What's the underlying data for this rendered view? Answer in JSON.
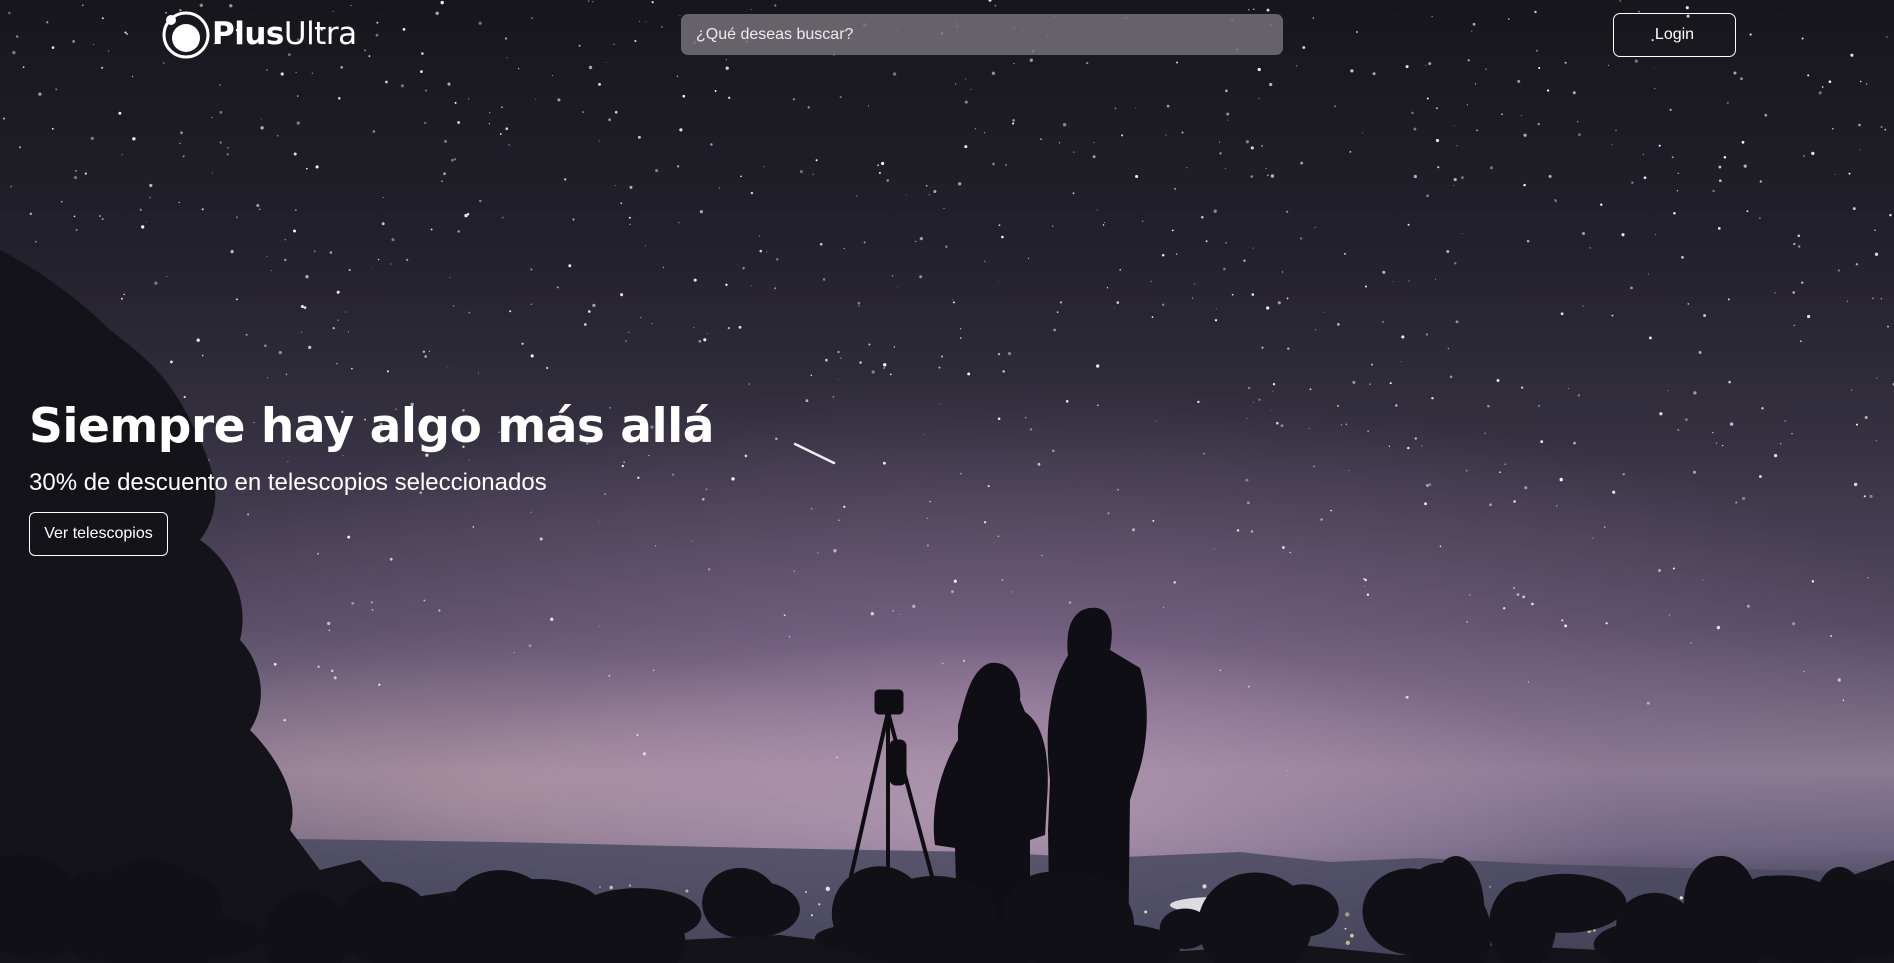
{
  "header": {
    "brand": {
      "bold": "Plus",
      "light": "Ultra",
      "icon": "logo-planet-icon"
    },
    "search": {
      "placeholder": "¿Qué deseas buscar?",
      "value": ""
    },
    "login_label": "Login"
  },
  "hero": {
    "headline": "Siempre hay algo más allá",
    "subheadline": "30% de descuento en telescopios seleccionados",
    "cta_label": "Ver telescopios",
    "background_image": "night-sky-stargazers-photo"
  },
  "colors": {
    "text": "#ffffff",
    "search_bg": "#737078",
    "sky_top": "#17161c",
    "horizon_glow": "#8a7a92"
  }
}
